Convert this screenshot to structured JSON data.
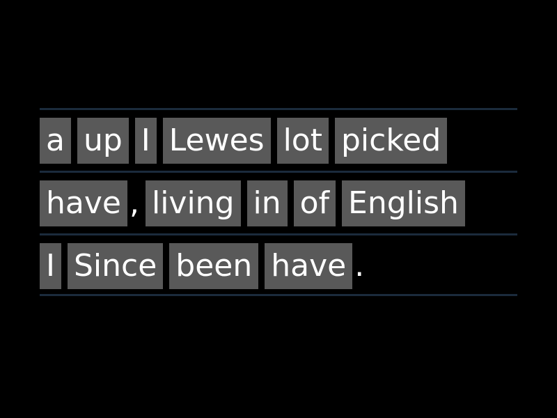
{
  "activity": {
    "type": "unjumble",
    "background_color": "#000000",
    "tile_color": "#595959",
    "tile_text_color": "#ffffff",
    "separator_color": "#1b2b3c"
  },
  "lines": [
    {
      "id": "line-1",
      "items": [
        {
          "kind": "tile",
          "text": "a"
        },
        {
          "kind": "tile",
          "text": "up"
        },
        {
          "kind": "tile",
          "text": "I"
        },
        {
          "kind": "tile",
          "text": "Lewes"
        },
        {
          "kind": "tile",
          "text": "lot"
        },
        {
          "kind": "tile",
          "text": "picked"
        }
      ]
    },
    {
      "id": "line-2",
      "items": [
        {
          "kind": "tile",
          "text": "have"
        },
        {
          "kind": "punct",
          "text": ","
        },
        {
          "kind": "tile",
          "text": "living"
        },
        {
          "kind": "tile",
          "text": "in"
        },
        {
          "kind": "tile",
          "text": "of"
        },
        {
          "kind": "tile",
          "text": "English"
        }
      ]
    },
    {
      "id": "line-3",
      "items": [
        {
          "kind": "tile",
          "text": "I"
        },
        {
          "kind": "tile",
          "text": "Since"
        },
        {
          "kind": "tile",
          "text": "been"
        },
        {
          "kind": "tile",
          "text": "have"
        },
        {
          "kind": "punct",
          "text": "."
        }
      ]
    }
  ]
}
